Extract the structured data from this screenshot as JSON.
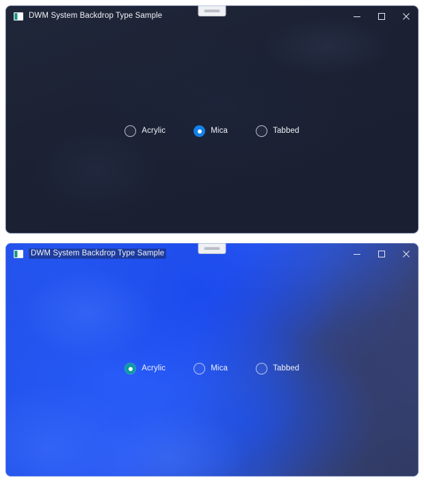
{
  "windows": [
    {
      "id": "mica-window",
      "title": "DWM System Backdrop Type Sample",
      "backdrop": "Mica",
      "icon_name": "app-icon",
      "title_highlighted": false,
      "snap_pill_name": "snap-layout-drag-pill",
      "controls": [
        {
          "name": "minimize-button",
          "glyph": "minimize"
        },
        {
          "name": "maximize-button",
          "glyph": "maximize"
        },
        {
          "name": "close-button",
          "glyph": "close"
        }
      ],
      "radio_group": {
        "name": "backdrop-type-radio-group",
        "selected": "Mica",
        "options": [
          {
            "label": "Acrylic",
            "selected": false
          },
          {
            "label": "Mica",
            "selected": true
          },
          {
            "label": "Tabbed",
            "selected": false
          }
        ]
      },
      "colors": {
        "background": "#1b2132",
        "accent": "#1381e8",
        "border": "#8ca0d2",
        "text": "#f2f4f8"
      }
    },
    {
      "id": "acrylic-window",
      "title": "DWM System Backdrop Type Sample",
      "backdrop": "Acrylic",
      "icon_name": "app-icon",
      "title_highlighted": true,
      "snap_pill_name": "snap-layout-drag-pill",
      "controls": [
        {
          "name": "minimize-button",
          "glyph": "minimize"
        },
        {
          "name": "maximize-button",
          "glyph": "maximize"
        },
        {
          "name": "close-button",
          "glyph": "close"
        }
      ],
      "radio_group": {
        "name": "backdrop-type-radio-group",
        "selected": "Acrylic",
        "options": [
          {
            "label": "Acrylic",
            "selected": true
          },
          {
            "label": "Mica",
            "selected": false
          },
          {
            "label": "Tabbed",
            "selected": false
          }
        ]
      },
      "colors": {
        "background": "#2452e6",
        "accent": "#0f9aa6",
        "border": "#8ca0d2",
        "text": "#f3f5f9"
      }
    }
  ]
}
